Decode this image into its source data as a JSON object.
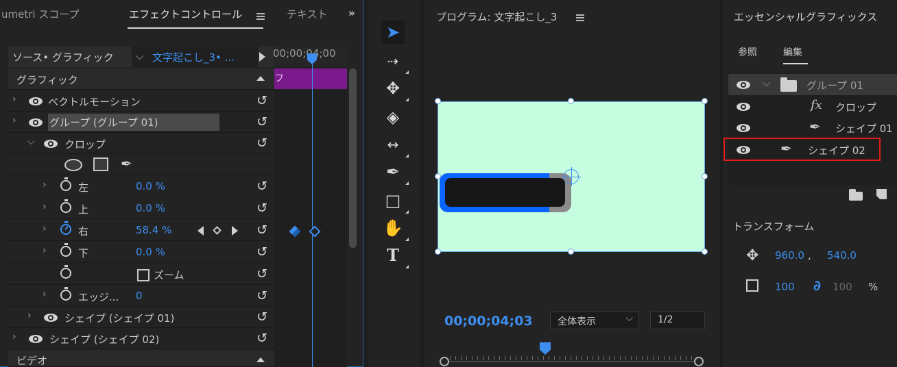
{
  "effect_controls": {
    "tabs": [
      "umetri スコープ",
      "エフェクトコントロール",
      "テキスト"
    ],
    "overflow_icon": "»",
    "source_label": "ソース• グラフィック",
    "clip_label": "文字起こし_3• ...",
    "timeline_time": "00;00;04;00",
    "timeline_clip_label": "フ",
    "graphics_header": "グラフィック",
    "rows": {
      "vector_motion": "ベクトルモーション",
      "group": "グループ (グループ 01)",
      "crop": "クロップ",
      "left_label": "左",
      "left_value": "0.0 %",
      "top_label": "上",
      "top_value": "0.0 %",
      "right_label": "右",
      "right_value": "58.4 %",
      "bottom_label": "下",
      "bottom_value": "0.0 %",
      "zoom_label": "ズーム",
      "edge_label": "エッジ...",
      "edge_value": "0",
      "shape01": "シェイプ (シェイプ 01)",
      "shape02": "シェイプ (シェイプ 02)",
      "video_header": "ビデオ"
    }
  },
  "program": {
    "title": "プログラム: 文字起こし_3",
    "timecode": "00;00;04;03",
    "fit": "全体表示",
    "resolution": "1/2",
    "canvas_color": "#c6fde0"
  },
  "essential_graphics": {
    "title": "エッセンシャルグラフィックス",
    "tabs": [
      "参照",
      "編集"
    ],
    "layers": {
      "group": "グループ 01",
      "crop": "クロップ",
      "crop_fx": "fx",
      "shape01": "シェイプ 01",
      "shape02": "シェイプ 02"
    },
    "transform_label": "トランスフォーム",
    "position_x": "960.0",
    "position_sep": ",",
    "position_y": "540.0",
    "scale": "100",
    "scale_linked": "100",
    "percent": "%"
  },
  "colors": {
    "accent": "#3d8ef0",
    "clip_purple": "#7b1a8c",
    "highlight_red": "#e01b1b"
  }
}
